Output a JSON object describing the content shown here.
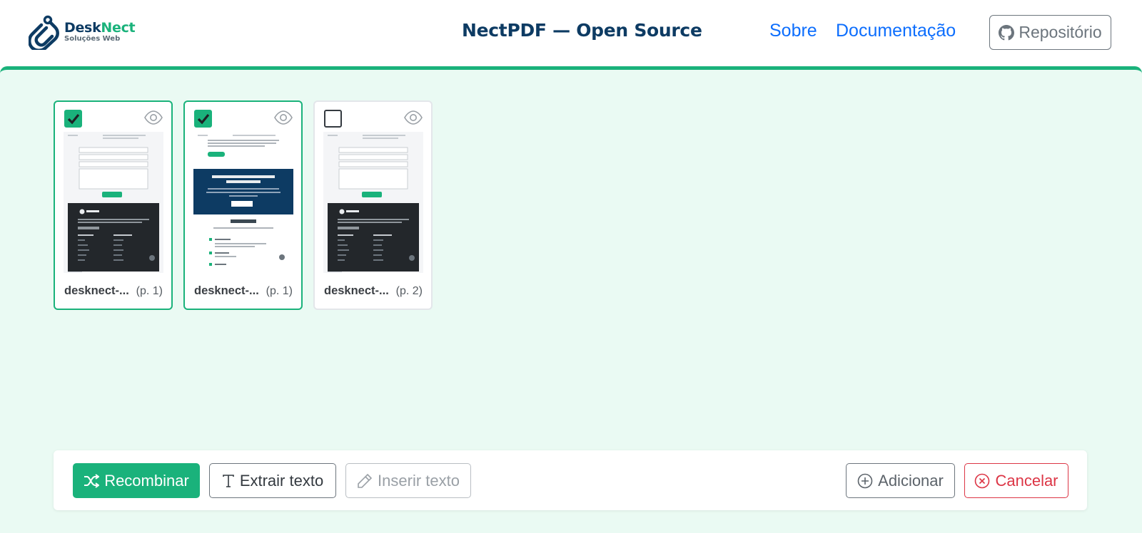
{
  "header": {
    "logo": {
      "name_part1": "Desk",
      "name_part2": "Nect",
      "subtitle": "Soluções Web"
    },
    "title": "NectPDF — Open Source",
    "nav": {
      "about": "Sobre",
      "docs": "Documentação"
    },
    "repo_button": "Repositório"
  },
  "pages": [
    {
      "filename": "desknect-...",
      "page": "(p. 1)",
      "selected": true
    },
    {
      "filename": "desknect-...",
      "page": "(p. 1)",
      "selected": true
    },
    {
      "filename": "desknect-...",
      "page": "(p. 2)",
      "selected": false
    }
  ],
  "toolbar": {
    "recombine": "Recombinar",
    "extract_text": "Extrair texto",
    "insert_text": "Inserir texto",
    "add": "Adicionar",
    "cancel": "Cancelar"
  },
  "colors": {
    "brand_green": "#1ab27b",
    "brand_navy": "#0d3b63",
    "link_blue": "#0d6efd",
    "danger": "#dc3545",
    "main_bg": "#eafaf3"
  },
  "icons": [
    "desknect-logo",
    "github-icon",
    "checkbox-checked",
    "checkbox-unchecked",
    "eye-icon",
    "shuffle-icon",
    "text-icon",
    "pencil-icon",
    "plus-circle-icon",
    "x-circle-icon"
  ]
}
